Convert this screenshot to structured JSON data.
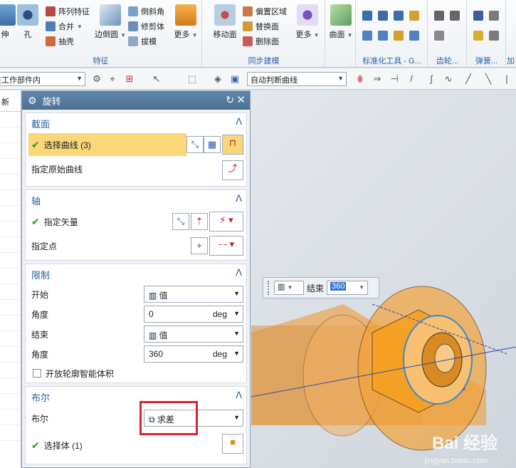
{
  "ribbon": {
    "groups": {
      "feature": {
        "label": "特征",
        "items": {
          "extrude_partial": "伸",
          "hole": "孔",
          "pattern": "阵列特征",
          "unite": "合并",
          "shell": "抽壳",
          "edge_blend": "边倒圆",
          "chamfer": "倒斜角",
          "trim_body": "修剪体",
          "draft": "拔模",
          "more": "更多"
        }
      },
      "sync": {
        "label": "同步建模",
        "items": {
          "move_face": "移动面",
          "offset_region": "偏置区域",
          "replace_face": "替换面",
          "delete_face": "删除面",
          "more": "更多"
        }
      },
      "surface": {
        "label": "",
        "items": {
          "surface": "曲面"
        }
      },
      "std_tools": {
        "label": "标准化工具 - G..."
      },
      "gear": {
        "label": "齿轮..."
      },
      "spring": {
        "label": "弹簧..."
      },
      "add": {
        "label": "加"
      }
    }
  },
  "toolbar": {
    "scope_select": "在工作部件内",
    "curve_rule": "自动判断曲线"
  },
  "navigator": {
    "header": "新"
  },
  "dialog": {
    "title": "旋转",
    "sections": {
      "section": {
        "title": "截面",
        "select_curve": "选择曲线 (3)",
        "specify_origin_curve": "指定原始曲线"
      },
      "axis": {
        "title": "轴",
        "specify_vector": "指定矢量",
        "specify_point": "指定点"
      },
      "limits": {
        "title": "限制",
        "start_label": "开始",
        "start_value": "值",
        "start_angle_label": "角度",
        "start_angle": "0",
        "end_label": "结束",
        "end_value": "值",
        "end_angle_label": "角度",
        "end_angle": "360",
        "unit": "deg",
        "open_profile": "开放轮廓智能体积"
      },
      "boolean": {
        "title": "布尔",
        "boolean_label": "布尔",
        "boolean_value": "求差",
        "select_body": "选择体 (1)"
      }
    }
  },
  "viewport": {
    "float_label": "结束",
    "float_value": "360",
    "watermark": "Bai 经验",
    "watermark_sub": "jingyan.baidu.com"
  },
  "colors": {
    "active_row": "#fad779",
    "section_title": "#2c5f9e",
    "highlight": "#e0212c",
    "model_orange": "#f2a33a"
  }
}
